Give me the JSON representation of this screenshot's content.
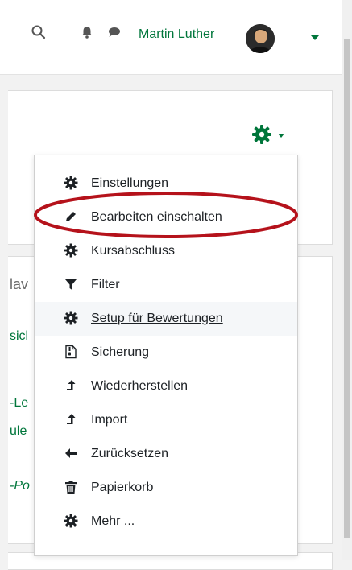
{
  "navbar": {
    "search_icon": "search-icon",
    "bell_icon": "bell-icon",
    "chat_icon": "chat-icon",
    "user_name": "Martin Luther",
    "user_color": "#00763b"
  },
  "background_fragments": {
    "nav": "lav",
    "link1": "sicl",
    "link2": "-Le",
    "link3": "ule",
    "link4": "-Po"
  },
  "menu": {
    "items": [
      {
        "label": "Einstellungen",
        "icon": "gear-icon"
      },
      {
        "label": "Bearbeiten einschalten",
        "icon": "pencil-icon"
      },
      {
        "label": "Kursabschluss",
        "icon": "gear-icon"
      },
      {
        "label": "Filter",
        "icon": "filter-icon"
      },
      {
        "label": "Setup für Bewertungen",
        "icon": "gear-icon"
      },
      {
        "label": "Sicherung",
        "icon": "file-archive-icon"
      },
      {
        "label": "Wiederherstellen",
        "icon": "level-up-icon"
      },
      {
        "label": "Import",
        "icon": "level-up-icon"
      },
      {
        "label": "Zurücksetzen",
        "icon": "arrow-left-icon"
      },
      {
        "label": "Papierkorb",
        "icon": "trash-icon"
      },
      {
        "label": "Mehr ...",
        "icon": "gear-icon"
      }
    ],
    "highlighted_item": "Setup für Bewertungen"
  },
  "colors": {
    "accent": "#00763b",
    "annotation": "#b5121b",
    "text": "#1d2125"
  }
}
